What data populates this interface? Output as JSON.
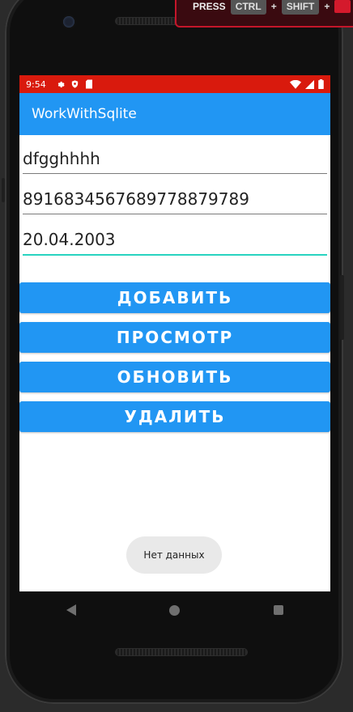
{
  "keyboard_overlay": {
    "label": "PRESS",
    "key1": "CTRL",
    "plus1": "+",
    "key2": "SHIFT",
    "plus2": "+"
  },
  "status_bar": {
    "time": "9:54",
    "left_icons": [
      "gear-icon",
      "shield-icon",
      "sd-card-icon"
    ],
    "right_icons": [
      "wifi-icon",
      "signal-icon",
      "battery-icon"
    ],
    "bg_color": "#d91a0d"
  },
  "app_bar": {
    "title": "WorkWithSqlite",
    "bg_color": "#2196f3"
  },
  "fields": [
    {
      "value": "dfgghhhh",
      "focused": false
    },
    {
      "value": "891683456768977887978 9",
      "focused": false
    },
    {
      "value": "20.04.2003",
      "focused": true
    }
  ],
  "buttons": {
    "add": "ДОБАВИТЬ",
    "view": "ПРОСМОТР",
    "update": "ОБНОВИТЬ",
    "delete": "УДАЛИТЬ"
  },
  "toast": {
    "text": "Нет данных"
  },
  "nav_bar": {
    "buttons": [
      "back-icon",
      "home-icon",
      "recent-apps-icon"
    ]
  }
}
